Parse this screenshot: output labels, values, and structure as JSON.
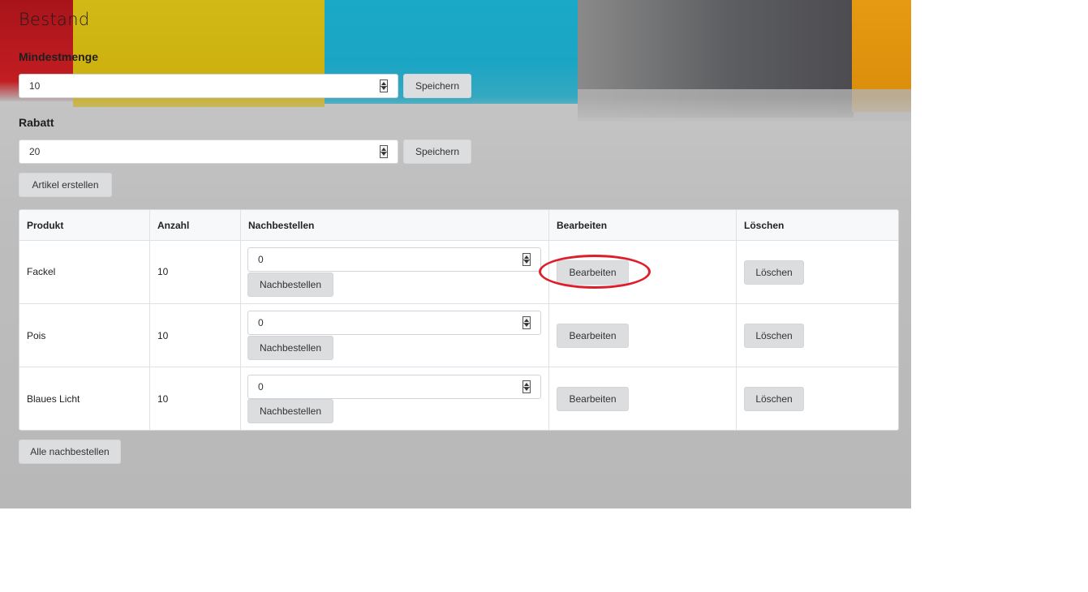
{
  "page": {
    "title": "Bestand"
  },
  "mindestmenge": {
    "label": "Mindestmenge",
    "value": "10",
    "save_label": "Speichern"
  },
  "rabatt": {
    "label": "Rabatt",
    "value": "20",
    "save_label": "Speichern"
  },
  "create_article_label": "Artikel erstellen",
  "table": {
    "headers": [
      "Produkt",
      "Anzahl",
      "Nachbestellen",
      "Bearbeiten",
      "Löschen"
    ],
    "rows": [
      {
        "product": "Fackel",
        "count": "10",
        "reorder_value": "0",
        "reorder_label": "Nachbestellen",
        "edit_label": "Bearbeiten",
        "delete_label": "Löschen"
      },
      {
        "product": "Pois",
        "count": "10",
        "reorder_value": "0",
        "reorder_label": "Nachbestellen",
        "edit_label": "Bearbeiten",
        "delete_label": "Löschen"
      },
      {
        "product": "Blaues Licht",
        "count": "10",
        "reorder_value": "0",
        "reorder_label": "Nachbestellen",
        "edit_label": "Bearbeiten",
        "delete_label": "Löschen"
      }
    ]
  },
  "reorder_all_label": "Alle nachbestellen",
  "colors": {
    "annotation": "#dd1f2b",
    "button_bg": "#dcdddf"
  }
}
